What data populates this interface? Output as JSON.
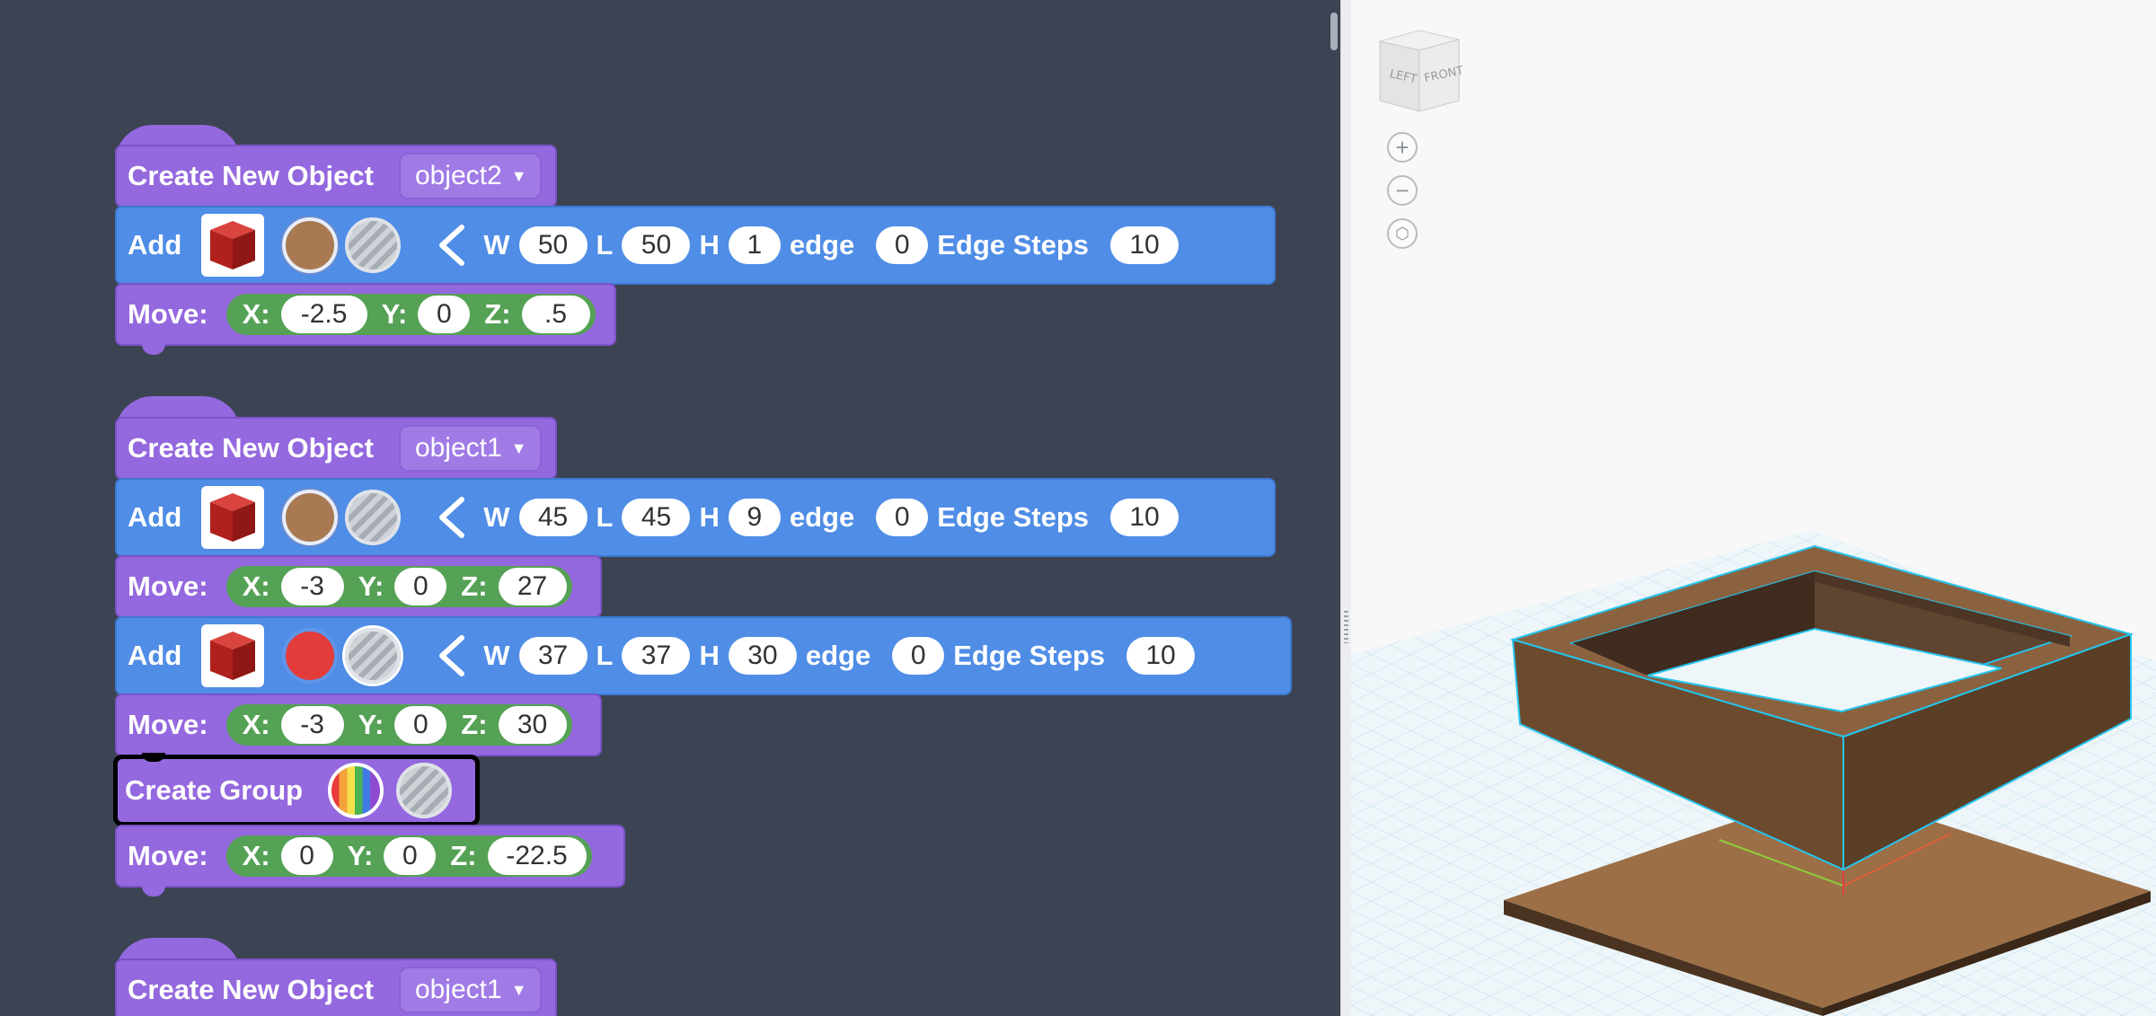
{
  "blocks": {
    "group1": {
      "create_label": "Create New Object",
      "object_name": "object2",
      "add": {
        "label": "Add",
        "w_label": "W",
        "w": "50",
        "l_label": "L",
        "l": "50",
        "h_label": "H",
        "h": "1",
        "edge_label": "edge",
        "edge": "0",
        "steps_label": "Edge Steps",
        "steps": "10"
      },
      "move": {
        "label": "Move:",
        "x_label": "X:",
        "x": "-2.5",
        "y_label": "Y:",
        "y": "0",
        "z_label": "Z:",
        "z": ".5"
      }
    },
    "group2": {
      "create_label": "Create New Object",
      "object_name": "object1",
      "add1": {
        "label": "Add",
        "w_label": "W",
        "w": "45",
        "l_label": "L",
        "l": "45",
        "h_label": "H",
        "h": "9",
        "edge_label": "edge",
        "edge": "0",
        "steps_label": "Edge Steps",
        "steps": "10"
      },
      "move1": {
        "label": "Move:",
        "x_label": "X:",
        "x": "-3",
        "y_label": "Y:",
        "y": "0",
        "z_label": "Z:",
        "z": "27"
      },
      "add2": {
        "label": "Add",
        "w_label": "W",
        "w": "37",
        "l_label": "L",
        "l": "37",
        "h_label": "H",
        "h": "30",
        "edge_label": "edge",
        "edge": "0",
        "steps_label": "Edge Steps",
        "steps": "10"
      },
      "move2": {
        "label": "Move:",
        "x_label": "X:",
        "x": "-3",
        "y_label": "Y:",
        "y": "0",
        "z_label": "Z:",
        "z": "30"
      },
      "create_group_label": "Create Group",
      "move3": {
        "label": "Move:",
        "x_label": "X:",
        "x": "0",
        "y_label": "Y:",
        "y": "0",
        "z_label": "Z:",
        "z": "-22.5"
      }
    },
    "group3": {
      "create_label": "Create New Object",
      "object_name": "object1"
    }
  },
  "viewport": {
    "viewcube": {
      "left_face": "LEFT",
      "front_face": "FRONT"
    },
    "colors": {
      "object": "#8b6240",
      "base": "#9c6f46",
      "grid": "#cfe6f1",
      "highlight": "#25c4ee"
    }
  },
  "icons": {
    "shape": "cube-icon",
    "direction": "chevron-left-icon",
    "zoom_in": "plus-icon",
    "zoom_out": "minus-icon",
    "fit": "fit-view-icon"
  }
}
